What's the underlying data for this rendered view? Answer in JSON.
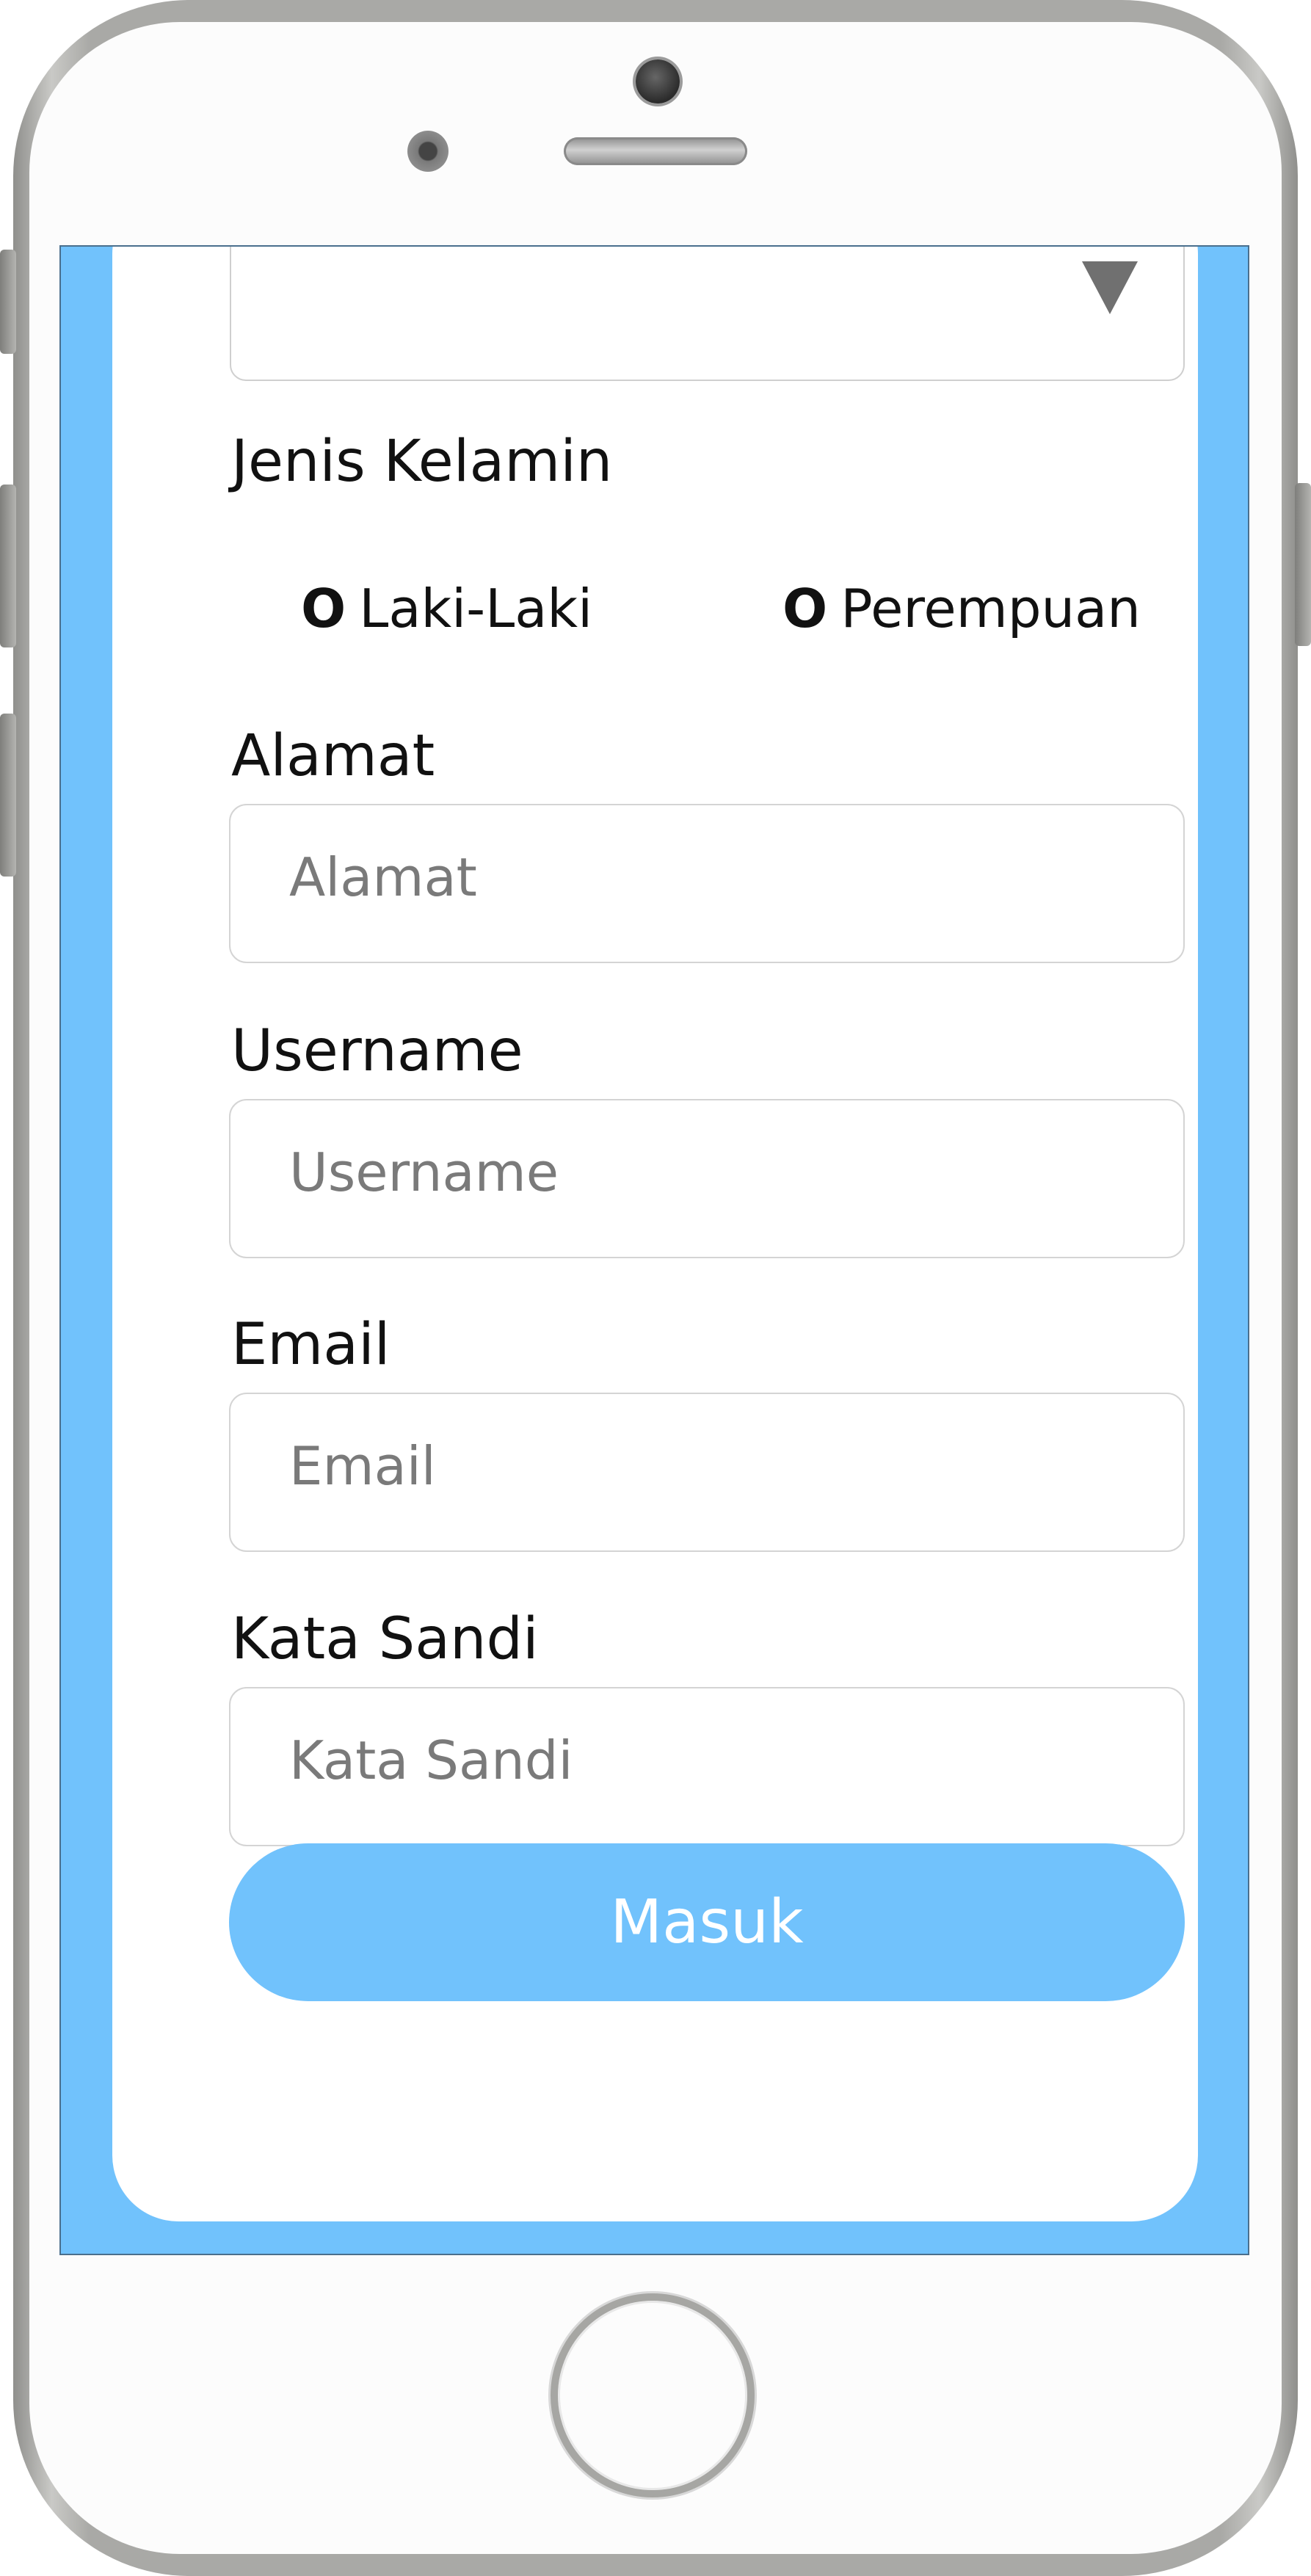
{
  "form": {
    "gender_label": "Jenis Kelamin",
    "gender_options": [
      {
        "mark": "O",
        "label": "Laki-Laki"
      },
      {
        "mark": "O",
        "label": "Perempuan"
      }
    ],
    "address_label": "Alamat",
    "address_placeholder": "Alamat",
    "username_label": "Username",
    "username_placeholder": "Username",
    "email_label": "Email",
    "email_placeholder": "Email",
    "password_label": "Kata Sandi",
    "password_placeholder": "Kata Sandi",
    "submit_label": "Masuk"
  },
  "colors": {
    "accent": "#71c2fc",
    "card": "#ffffff",
    "phone_frame": "#a9a9a6"
  },
  "icons": {
    "dropdown": "triangle-down-icon"
  }
}
